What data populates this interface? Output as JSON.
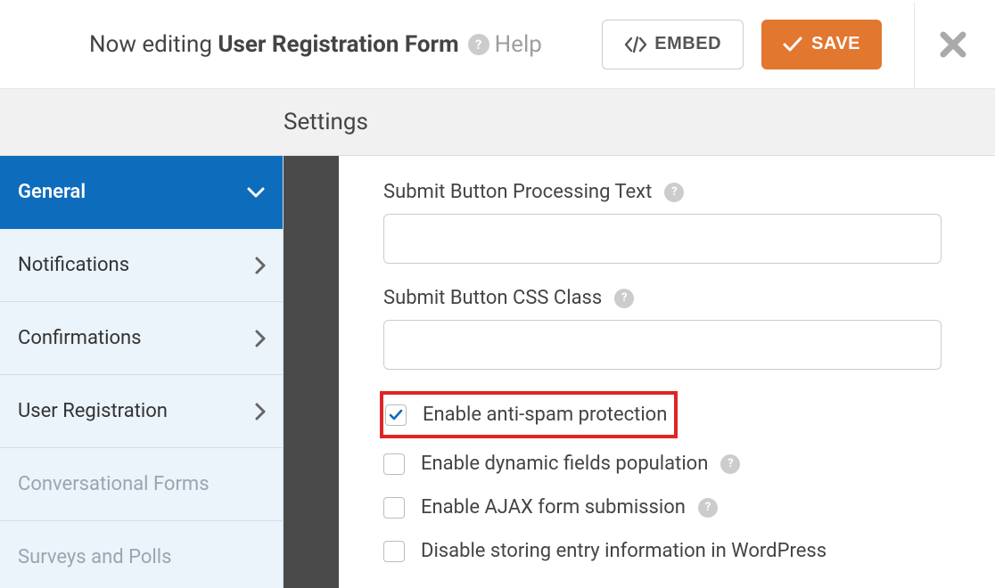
{
  "topbar": {
    "now_editing_prefix": "Now editing ",
    "form_name": "User Registration Form",
    "help_label": "Help",
    "embed_label": "EMBED",
    "save_label": "SAVE"
  },
  "settings_heading": "Settings",
  "sidebar": {
    "items": [
      {
        "label": "General",
        "active": true,
        "expanded": true,
        "disabled": false
      },
      {
        "label": "Notifications",
        "active": false,
        "expanded": false,
        "disabled": false
      },
      {
        "label": "Confirmations",
        "active": false,
        "expanded": false,
        "disabled": false
      },
      {
        "label": "User Registration",
        "active": false,
        "expanded": false,
        "disabled": false
      },
      {
        "label": "Conversational Forms",
        "active": false,
        "expanded": false,
        "disabled": true
      },
      {
        "label": "Surveys and Polls",
        "active": false,
        "expanded": false,
        "disabled": true
      }
    ]
  },
  "content": {
    "fields": [
      {
        "label": "Submit Button Processing Text",
        "value": "",
        "help": true
      },
      {
        "label": "Submit Button CSS Class",
        "value": "",
        "help": true
      }
    ],
    "checkboxes": [
      {
        "label": "Enable anti-spam protection",
        "checked": true,
        "help": false,
        "highlight": true
      },
      {
        "label": "Enable dynamic fields population",
        "checked": false,
        "help": true,
        "highlight": false
      },
      {
        "label": "Enable AJAX form submission",
        "checked": false,
        "help": true,
        "highlight": false
      },
      {
        "label": "Disable storing entry information in WordPress",
        "checked": false,
        "help": false,
        "highlight": false
      }
    ]
  }
}
